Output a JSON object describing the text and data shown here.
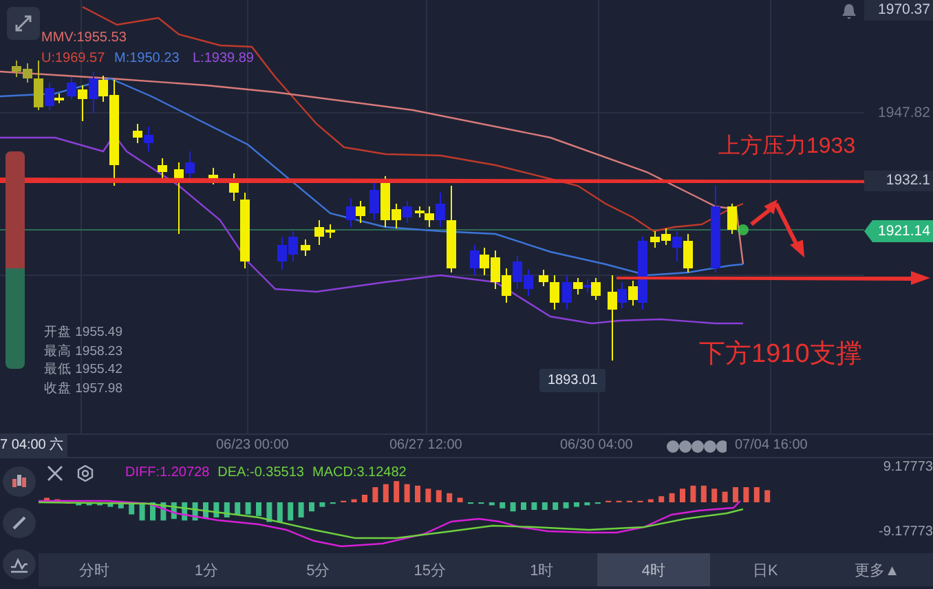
{
  "chart": {
    "price_axis": [
      "1970.37",
      "1947.82",
      "1932.1"
    ],
    "current_price": "1921.14",
    "indicator": [
      {
        "kind": "mmv",
        "text": "MMV:1955.53"
      },
      {
        "kind": "upper",
        "text": "U:1969.57"
      },
      {
        "kind": "middle",
        "text": "M:1950.23"
      },
      {
        "kind": "lower",
        "text": "L:1939.89"
      }
    ],
    "sentiment_bar": {
      "level": 0.54
    },
    "ohlc": [
      {
        "label": "开盘",
        "value": "1955.49"
      },
      {
        "label": "最高",
        "value": "1958.23"
      },
      {
        "label": "最低",
        "value": "1955.42"
      },
      {
        "label": "收盘",
        "value": "1957.98"
      }
    ],
    "annotations": [
      {
        "kind": "resistance",
        "text": "上方压力1933"
      },
      {
        "kind": "support",
        "text": "下方1910支撑"
      }
    ],
    "low_marker": "1893.01",
    "time_axis": {
      "crosshair": "7 04:00 六",
      "labels": [
        "06/23 00:00",
        "06/27 12:00",
        "06/30 04:00",
        "07/04 16:00"
      ]
    }
  },
  "macd": {
    "values": [
      "DIFF:1.20728",
      "DEA:-0.35513",
      "MACD:3.12482"
    ],
    "max": "9.17773",
    "min": "-9.17773"
  },
  "timeframes": [
    {
      "label": "分时",
      "selected": false
    },
    {
      "label": "1分",
      "selected": false
    },
    {
      "label": "5分",
      "selected": false
    },
    {
      "label": "15分",
      "selected": false
    },
    {
      "label": "1时",
      "selected": false
    },
    {
      "label": "4时",
      "selected": true
    },
    {
      "label": "日K",
      "selected": false
    },
    {
      "label": "更多▲",
      "selected": false
    }
  ]
}
